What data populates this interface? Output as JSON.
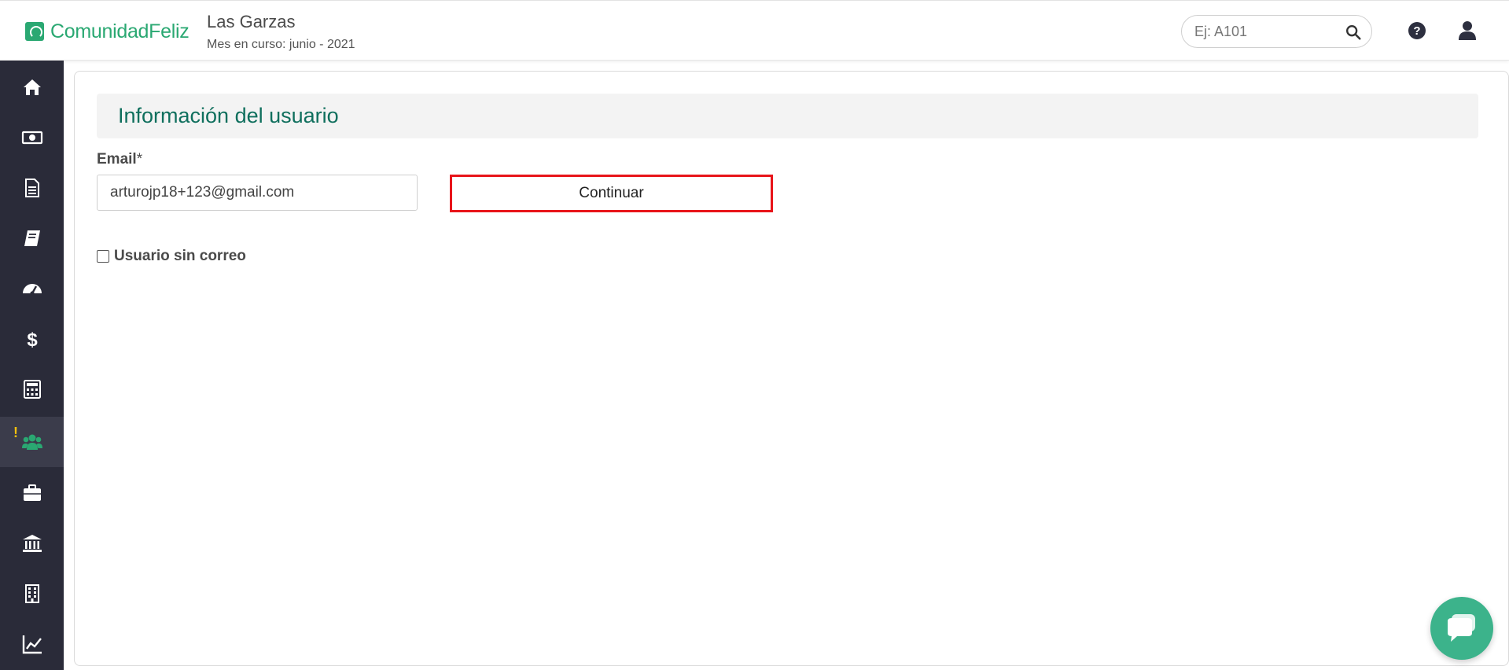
{
  "header": {
    "logo_text": "ComunidadFeliz",
    "community_name": "Las Garzas",
    "current_month": "Mes en curso: junio - 2021",
    "search_placeholder": "Ej: A101"
  },
  "sidebar": {
    "items": [
      {
        "icon": "home-icon"
      },
      {
        "icon": "money-bill-icon"
      },
      {
        "icon": "document-icon"
      },
      {
        "icon": "book-icon"
      },
      {
        "icon": "dashboard-gauge-icon"
      },
      {
        "icon": "dollar-icon"
      },
      {
        "icon": "calculator-icon"
      },
      {
        "icon": "users-icon",
        "active": true,
        "alert": "!"
      },
      {
        "icon": "briefcase-icon"
      },
      {
        "icon": "bank-icon"
      },
      {
        "icon": "building-icon"
      },
      {
        "icon": "chart-line-icon"
      }
    ]
  },
  "main": {
    "section_title": "Información del usuario",
    "email_label": "Email",
    "email_required_mark": "*",
    "email_value": "arturojp18+123@gmail.com",
    "continue_label": "Continuar",
    "no_email_label": "Usuario sin correo",
    "no_email_checked": false
  },
  "colors": {
    "brand_green": "#2aa872",
    "title_green": "#0f6f5d",
    "sidebar_bg": "#2a2b39",
    "highlight_red": "#e8141a",
    "alert_yellow": "#f3c10e",
    "chat_green": "#3cb38b"
  }
}
